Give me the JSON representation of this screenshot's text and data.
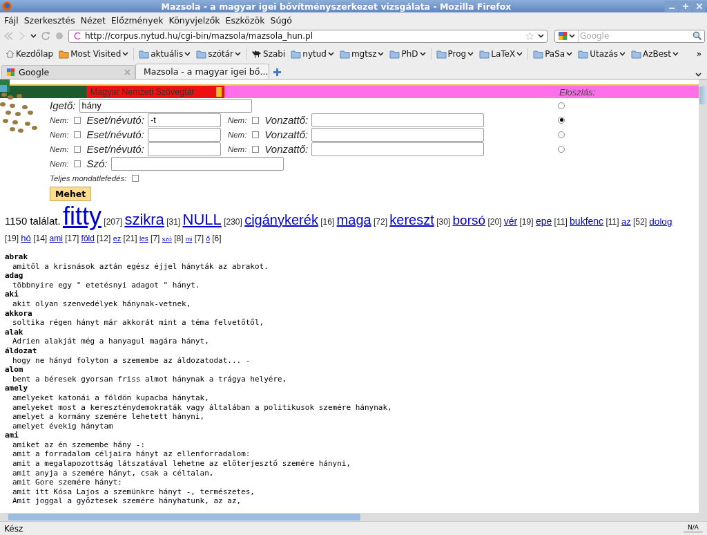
{
  "window": {
    "title": "Mazsola - a magyar igei bővítményszerkezet vizsgálata - Mozilla Firefox"
  },
  "menu": [
    "Fájl",
    "Szerkesztés",
    "Nézet",
    "Előzmények",
    "Könyvjelzők",
    "Eszközök",
    "Súgó"
  ],
  "address": {
    "url": "http://corpus.nytud.hu/cgi-bin/mazsola/mazsola_hun.pl"
  },
  "search": {
    "placeholder": "Google"
  },
  "bookmarks": [
    {
      "label": "Kezdőlap",
      "kind": "home",
      "dropdown": false
    },
    {
      "label": "Most Visited",
      "kind": "recent",
      "dropdown": true
    },
    {
      "label": "aktuális",
      "kind": "folder",
      "dropdown": true
    },
    {
      "label": "szótár",
      "kind": "folder",
      "dropdown": true
    },
    {
      "label": "Szabi",
      "kind": "animal",
      "dropdown": false
    },
    {
      "label": "nytud",
      "kind": "folder",
      "dropdown": true
    },
    {
      "label": "mgtsz",
      "kind": "folder",
      "dropdown": true
    },
    {
      "label": "PhD",
      "kind": "folder",
      "dropdown": true
    },
    {
      "label": "Prog",
      "kind": "folder",
      "dropdown": true
    },
    {
      "label": "LaTeX",
      "kind": "folder",
      "dropdown": true
    },
    {
      "label": "PaSa",
      "kind": "folder",
      "dropdown": true
    },
    {
      "label": "Utazás",
      "kind": "folder",
      "dropdown": true
    },
    {
      "label": "AzBest",
      "kind": "folder",
      "dropdown": true
    }
  ],
  "bookmarks_more": "»",
  "tabs": [
    {
      "label": "Google",
      "kind": "google",
      "selected": false
    },
    {
      "label": "Mazsola - a magyar igei bő...",
      "kind": "page",
      "selected": true
    }
  ],
  "banner": {
    "corpus": "Magyar Nemzeti Szövegtár",
    "distribution_label": "Eloszlás:"
  },
  "form": {
    "verb_label": "Igető:",
    "verb_value": "hány",
    "rows": [
      {
        "kind": "pair",
        "neg_label": "Nem:",
        "neg_checked": false,
        "label": "Eset/névutó:",
        "value": "-t",
        "neg2_label": "Nem:",
        "neg2_checked": false,
        "label2": "Vonzattő:",
        "value2": ""
      },
      {
        "kind": "pair",
        "neg_label": "Nem:",
        "neg_checked": false,
        "label": "Eset/névutó:",
        "value": "",
        "neg2_label": "Nem:",
        "neg2_checked": false,
        "label2": "Vonzattő:",
        "value2": ""
      },
      {
        "kind": "pair",
        "neg_label": "Nem:",
        "neg_checked": false,
        "label": "Eset/névutó:",
        "value": "",
        "neg2_label": "Nem:",
        "neg2_checked": false,
        "label2": "Vonzattő:",
        "value2": ""
      },
      {
        "kind": "word",
        "neg_label": "Nem:",
        "neg_checked": false,
        "label": "Szó:",
        "value": ""
      }
    ],
    "full_label": "Teljes mondatlefedés:",
    "full_checked": false,
    "submit": "Mehet",
    "distribution": [
      {
        "selected": false
      },
      {
        "selected": true
      },
      {
        "selected": false
      },
      {
        "selected": false
      }
    ]
  },
  "summary": "1150 találat.",
  "keywords": [
    {
      "word": "fitty",
      "count": "[207]"
    },
    {
      "word": "szikra",
      "count": "[31]"
    },
    {
      "word": "NULL",
      "count": "[230]"
    },
    {
      "word": "cigánykerék",
      "count": "[16]"
    },
    {
      "word": "maga",
      "count": "[72]"
    },
    {
      "word": "kereszt",
      "count": "[30]"
    },
    {
      "word": "borsó",
      "count": "[20]"
    },
    {
      "word": "vér",
      "count": "[19]"
    },
    {
      "word": "epe",
      "count": "[11]"
    },
    {
      "word": "bukfenc",
      "count": "[11]"
    },
    {
      "word": "az",
      "count": "[52]"
    },
    {
      "word": "dolog",
      "count": "[19]"
    },
    {
      "word": "hó",
      "count": "[14]"
    },
    {
      "word": "ami",
      "count": "[17]"
    },
    {
      "word": "föld",
      "count": "[12]"
    },
    {
      "word": "ez",
      "count": "[21]"
    },
    {
      "word": "les",
      "count": "[7]"
    },
    {
      "word": "szó",
      "count": "[8]"
    },
    {
      "word": "mi",
      "count": "[7]"
    },
    {
      "word": "ő",
      "count": "[6]"
    }
  ],
  "results": [
    {
      "word": "abrak",
      "sentences": [
        "amitől a krisnások aztán egész éjjel hányták az abrakot."
      ]
    },
    {
      "word": "adag",
      "sentences": [
        "többnyire egy \" etetésnyi adagot \" hányt."
      ]
    },
    {
      "word": "aki",
      "sentences": [
        "akit olyan szenvedélyek hánynak-vetnek,"
      ]
    },
    {
      "word": "akkora",
      "sentences": [
        "soltika régen hányt már akkorát mint a téma felvetőtől,"
      ]
    },
    {
      "word": "alak",
      "sentences": [
        "Adrien alakját még a hanyagul magára hányt,"
      ]
    },
    {
      "word": "áldozat",
      "sentences": [
        "hogy ne hányd folyton a szemembe az áldozatodat... -"
      ]
    },
    {
      "word": "alom",
      "sentences": [
        "bent a béresek gyorsan friss almot hánynak a trágya helyére,"
      ]
    },
    {
      "word": "amely",
      "sentences": [
        "amelyeket katonái a földön kupacba hánytak,",
        "amelyeket most a kereszténydemokraták vagy általában a politikusok szemére hánynak,",
        "amelyet a kormány szemére lehetett hányni,",
        "amelyet évekig hánytam"
      ]
    },
    {
      "word": "ami",
      "sentences": [
        "amiket az én szemembe hány -:",
        "amit a forradalom céljaira hányt az ellenforradalom:",
        "amit a megalapozottság látszatával lehetne az előterjesztő szemére hányni,",
        "amit anyja a szemére hányt, csak a céltalan,",
        "amit Gore szemére hányt:",
        "amit itt Kósa Lajos a szemünkre hányt -, természetes,",
        "Amit joggal a győztesek szemére hányhatunk, az az,"
      ]
    }
  ],
  "status": {
    "text": "Kész",
    "right": "N/A"
  }
}
